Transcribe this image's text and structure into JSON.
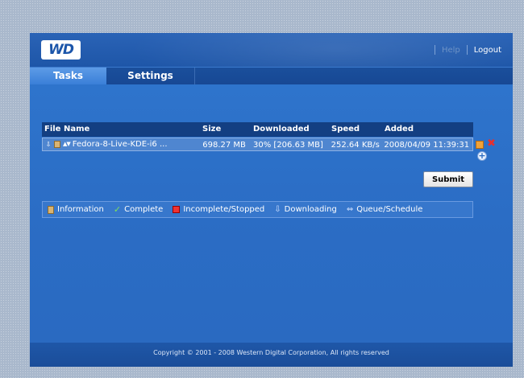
{
  "header": {
    "logo_text": "WD",
    "help_label": "Help",
    "logout_label": "Logout"
  },
  "tabs": [
    {
      "label": "Tasks",
      "active": true
    },
    {
      "label": "Settings",
      "active": false
    }
  ],
  "table": {
    "columns": [
      "File Name",
      "Size",
      "Downloaded",
      "Speed",
      "Added"
    ],
    "rows": [
      {
        "file_name": "Fedora-8-Live-KDE-i6 ...",
        "size": "698.27 MB",
        "downloaded": "30% [206.63 MB]",
        "speed": "252.64 KB/s",
        "added": "2008/04/09 11:39:31"
      }
    ]
  },
  "submit_label": "Submit",
  "legend": [
    {
      "icon": "information-icon",
      "label": "Information"
    },
    {
      "icon": "complete-check-icon",
      "label": "Complete"
    },
    {
      "icon": "stopped-square-icon",
      "label": "Incomplete/Stopped"
    },
    {
      "icon": "download-arrow-icon",
      "label": "Downloading"
    },
    {
      "icon": "queue-arrows-icon",
      "label": "Queue/Schedule"
    }
  ],
  "footer": "Copyright © 2001 - 2008 Western Digital Corporation, All rights reserved",
  "colors": {
    "brand_blue": "#2b6bc0",
    "table_header": "#133f82",
    "row_bg": "#4f86d0",
    "delete_red": "#e53030"
  }
}
